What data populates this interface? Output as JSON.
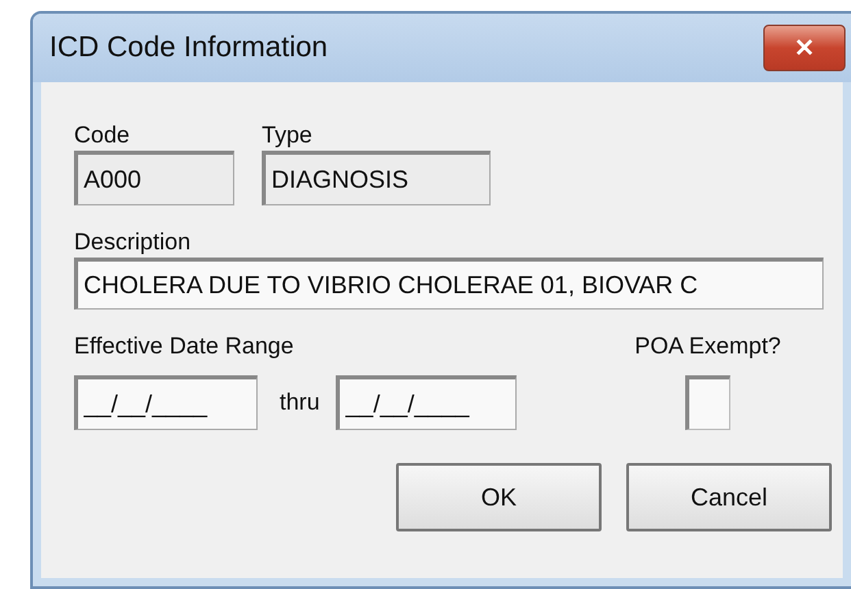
{
  "window": {
    "title": "ICD Code Information",
    "close": "✕"
  },
  "code": {
    "label": "Code",
    "value": "A000"
  },
  "type": {
    "label": "Type",
    "value": "DIAGNOSIS"
  },
  "description": {
    "label": "Description",
    "value": "CHOLERA DUE TO VIBRIO CHOLERAE 01, BIOVAR C"
  },
  "date_range": {
    "label": "Effective Date Range",
    "from": "__/__/____",
    "separator": "thru",
    "to": "__/__/____"
  },
  "poa_exempt": {
    "label": "POA Exempt?",
    "checked": false
  },
  "buttons": [
    "OK",
    "Cancel"
  ]
}
